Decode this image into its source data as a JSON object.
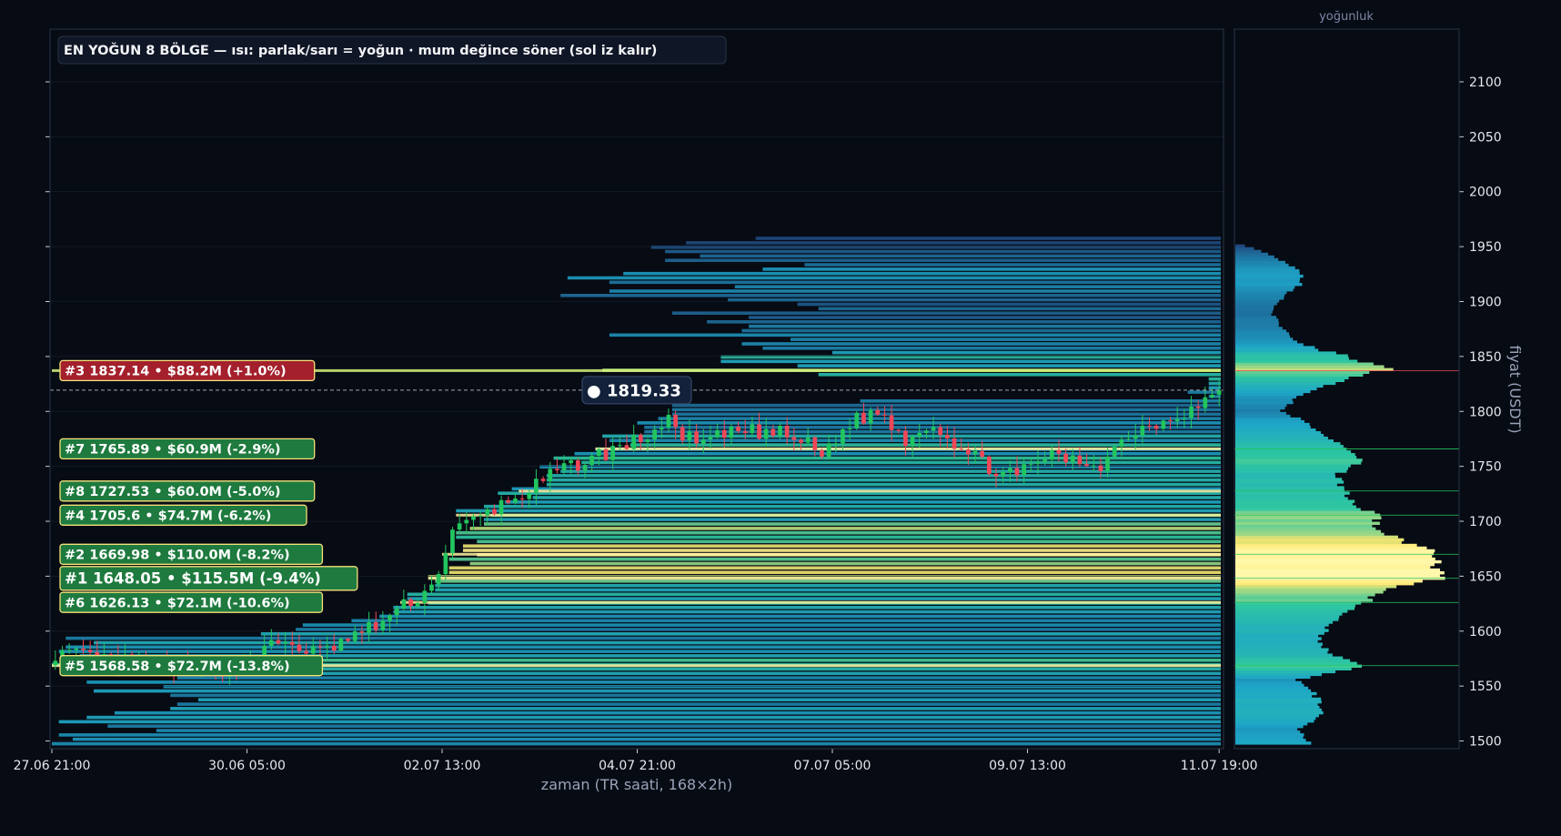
{
  "colors": {
    "background": "#070b14",
    "panel_border": "#2a3446",
    "up_candle": "#22c55e",
    "down_candle": "#ef4757",
    "heat_low": "#1f3b73",
    "heat_mid": "#1ea5c8",
    "heat_high": "#ffe66d",
    "label_green": "#1e7a3e",
    "label_red": "#a3202c",
    "label_border": "#f5e27a",
    "text": "#e5e7eb",
    "muted_text": "#9aa3b8"
  },
  "chart_data": {
    "type": "candlestick-heatmap",
    "title": "EN YOĞUN 8 BÖLGE — ısı: parlak/sarı = yoğun · mum değince söner (sol iz kalır)",
    "xlabel": "zaman (TR saati, 168×2h)",
    "ylabel": "fiyat (USDT)",
    "side_panel_label": "yoğunluk",
    "ylim": [
      1493,
      2148
    ],
    "yticks": [
      1500,
      1550,
      1600,
      1650,
      1700,
      1750,
      1800,
      1850,
      1900,
      1950,
      2000,
      2050,
      2100
    ],
    "xlim": [
      0,
      168
    ],
    "xtick_labels": [
      "27.06 21:00",
      "30.06 05:00",
      "02.07 13:00",
      "04.07 21:00",
      "07.07 05:00",
      "09.07 13:00",
      "11.07 19:00"
    ],
    "xtick_positions": [
      0,
      28,
      56,
      84,
      112,
      140,
      167
    ],
    "current_price": 1819.33,
    "current_price_label": "● 1819.33",
    "zones": [
      {
        "rank": 1,
        "label": "#1  1648.05  •  $115.5M  (-9.4%)",
        "price": 1648.05,
        "volume_m": 115.5,
        "pct": -9.4,
        "side": "below"
      },
      {
        "rank": 2,
        "label": "#2  1669.98  •  $110.0M  (-8.2%)",
        "price": 1669.98,
        "volume_m": 110.0,
        "pct": -8.2,
        "side": "below"
      },
      {
        "rank": 3,
        "label": "#3  1837.14  •  $88.2M  (+1.0%)",
        "price": 1837.14,
        "volume_m": 88.2,
        "pct": 1.0,
        "side": "above"
      },
      {
        "rank": 4,
        "label": "#4  1705.6  •  $74.7M  (-6.2%)",
        "price": 1705.6,
        "volume_m": 74.7,
        "pct": -6.2,
        "side": "below"
      },
      {
        "rank": 5,
        "label": "#5  1568.58  •  $72.7M  (-13.8%)",
        "price": 1568.58,
        "volume_m": 72.7,
        "pct": -13.8,
        "side": "below"
      },
      {
        "rank": 6,
        "label": "#6  1626.13  •  $72.1M  (-10.6%)",
        "price": 1626.13,
        "volume_m": 72.1,
        "pct": -10.6,
        "side": "below"
      },
      {
        "rank": 7,
        "label": "#7  1765.89  •  $60.9M  (-2.9%)",
        "price": 1765.89,
        "volume_m": 60.9,
        "pct": -2.9,
        "side": "below"
      },
      {
        "rank": 8,
        "label": "#8  1727.53  •  $60.0M  (-5.0%)",
        "price": 1727.53,
        "volume_m": 60.0,
        "pct": -5.0,
        "side": "below"
      }
    ],
    "close_anchors": [
      [
        0,
        1580
      ],
      [
        10,
        1572
      ],
      [
        20,
        1565
      ],
      [
        26,
        1566
      ],
      [
        32,
        1590
      ],
      [
        38,
        1580
      ],
      [
        46,
        1605
      ],
      [
        54,
        1640
      ],
      [
        57,
        1690
      ],
      [
        62,
        1708
      ],
      [
        68,
        1728
      ],
      [
        72,
        1745
      ],
      [
        78,
        1760
      ],
      [
        84,
        1775
      ],
      [
        88,
        1790
      ],
      [
        92,
        1770
      ],
      [
        98,
        1782
      ],
      [
        104,
        1780
      ],
      [
        108,
        1770
      ],
      [
        110,
        1760
      ],
      [
        114,
        1790
      ],
      [
        118,
        1800
      ],
      [
        122,
        1775
      ],
      [
        126,
        1790
      ],
      [
        130,
        1765
      ],
      [
        134,
        1750
      ],
      [
        138,
        1740
      ],
      [
        142,
        1760
      ],
      [
        146,
        1755
      ],
      [
        150,
        1752
      ],
      [
        154,
        1780
      ],
      [
        160,
        1795
      ],
      [
        164,
        1805
      ],
      [
        167,
        1819.33
      ]
    ],
    "density_profile": [
      [
        1497,
        0.35
      ],
      [
        1510,
        0.3
      ],
      [
        1520,
        0.4
      ],
      [
        1530,
        0.42
      ],
      [
        1545,
        0.36
      ],
      [
        1555,
        0.3
      ],
      [
        1568.58,
        0.63
      ],
      [
        1578,
        0.45
      ],
      [
        1590,
        0.4
      ],
      [
        1605,
        0.45
      ],
      [
        1615,
        0.52
      ],
      [
        1626.13,
        0.62
      ],
      [
        1635,
        0.7
      ],
      [
        1648.05,
        1.0
      ],
      [
        1658,
        0.98
      ],
      [
        1669.98,
        0.95
      ],
      [
        1680,
        0.78
      ],
      [
        1695,
        0.68
      ],
      [
        1705.6,
        0.67
      ],
      [
        1715,
        0.55
      ],
      [
        1727.53,
        0.52
      ],
      [
        1740,
        0.48
      ],
      [
        1752,
        0.6
      ],
      [
        1765.89,
        0.53
      ],
      [
        1778,
        0.4
      ],
      [
        1790,
        0.32
      ],
      [
        1800,
        0.22
      ],
      [
        1812,
        0.3
      ],
      [
        1824,
        0.45
      ],
      [
        1837.14,
        0.73
      ],
      [
        1848,
        0.55
      ],
      [
        1860,
        0.3
      ],
      [
        1875,
        0.22
      ],
      [
        1890,
        0.17
      ],
      [
        1905,
        0.24
      ],
      [
        1918,
        0.33
      ],
      [
        1930,
        0.28
      ],
      [
        1945,
        0.12
      ],
      [
        1950,
        0.04
      ]
    ]
  }
}
